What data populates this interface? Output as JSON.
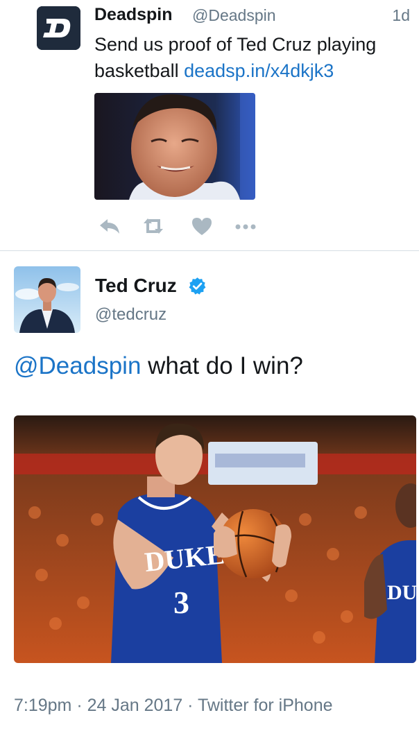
{
  "tweet1": {
    "display_name": "Deadspin",
    "handle": "@Deadspin",
    "time": "1d",
    "text": "Send us proof of Ted Cruz playing basketball",
    "link": "deadsp.in/x4dkjk3",
    "avatar_letter": "D",
    "photo_description": "Ted Cruz smiling",
    "actions": [
      "reply-icon",
      "retweet-icon",
      "like-icon",
      "more-icon"
    ]
  },
  "tweet2": {
    "display_name": "Ted Cruz",
    "handle": "@tedcruz",
    "verified": true,
    "mention": "@Deadspin",
    "text": " what do I win?",
    "jersey_text": "DUKE",
    "jersey_number": "3",
    "jersey_text_partial": "DU",
    "meta": "7:19pm · 24 Jan 2017 · Twitter for iPhone"
  },
  "colors": {
    "link": "#1b74c7",
    "secondary_text": "#657786",
    "verified": "#1da1f2",
    "action_icons": "#aab8c2",
    "deadspin_brand": "#1f2b3c",
    "duke_blue": "#1b3fa0"
  }
}
